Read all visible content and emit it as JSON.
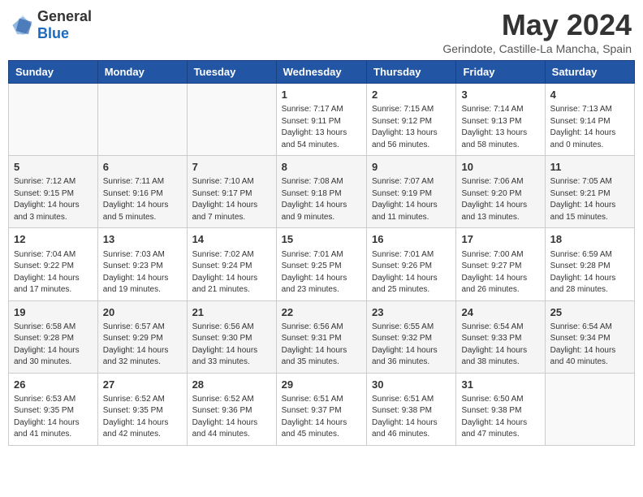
{
  "logo": {
    "general": "General",
    "blue": "Blue"
  },
  "title": "May 2024",
  "subtitle": "Gerindote, Castille-La Mancha, Spain",
  "days_of_week": [
    "Sunday",
    "Monday",
    "Tuesday",
    "Wednesday",
    "Thursday",
    "Friday",
    "Saturday"
  ],
  "weeks": [
    [
      {
        "day": "",
        "info": ""
      },
      {
        "day": "",
        "info": ""
      },
      {
        "day": "",
        "info": ""
      },
      {
        "day": "1",
        "info": "Sunrise: 7:17 AM\nSunset: 9:11 PM\nDaylight: 13 hours\nand 54 minutes."
      },
      {
        "day": "2",
        "info": "Sunrise: 7:15 AM\nSunset: 9:12 PM\nDaylight: 13 hours\nand 56 minutes."
      },
      {
        "day": "3",
        "info": "Sunrise: 7:14 AM\nSunset: 9:13 PM\nDaylight: 13 hours\nand 58 minutes."
      },
      {
        "day": "4",
        "info": "Sunrise: 7:13 AM\nSunset: 9:14 PM\nDaylight: 14 hours\nand 0 minutes."
      }
    ],
    [
      {
        "day": "5",
        "info": "Sunrise: 7:12 AM\nSunset: 9:15 PM\nDaylight: 14 hours\nand 3 minutes."
      },
      {
        "day": "6",
        "info": "Sunrise: 7:11 AM\nSunset: 9:16 PM\nDaylight: 14 hours\nand 5 minutes."
      },
      {
        "day": "7",
        "info": "Sunrise: 7:10 AM\nSunset: 9:17 PM\nDaylight: 14 hours\nand 7 minutes."
      },
      {
        "day": "8",
        "info": "Sunrise: 7:08 AM\nSunset: 9:18 PM\nDaylight: 14 hours\nand 9 minutes."
      },
      {
        "day": "9",
        "info": "Sunrise: 7:07 AM\nSunset: 9:19 PM\nDaylight: 14 hours\nand 11 minutes."
      },
      {
        "day": "10",
        "info": "Sunrise: 7:06 AM\nSunset: 9:20 PM\nDaylight: 14 hours\nand 13 minutes."
      },
      {
        "day": "11",
        "info": "Sunrise: 7:05 AM\nSunset: 9:21 PM\nDaylight: 14 hours\nand 15 minutes."
      }
    ],
    [
      {
        "day": "12",
        "info": "Sunrise: 7:04 AM\nSunset: 9:22 PM\nDaylight: 14 hours\nand 17 minutes."
      },
      {
        "day": "13",
        "info": "Sunrise: 7:03 AM\nSunset: 9:23 PM\nDaylight: 14 hours\nand 19 minutes."
      },
      {
        "day": "14",
        "info": "Sunrise: 7:02 AM\nSunset: 9:24 PM\nDaylight: 14 hours\nand 21 minutes."
      },
      {
        "day": "15",
        "info": "Sunrise: 7:01 AM\nSunset: 9:25 PM\nDaylight: 14 hours\nand 23 minutes."
      },
      {
        "day": "16",
        "info": "Sunrise: 7:01 AM\nSunset: 9:26 PM\nDaylight: 14 hours\nand 25 minutes."
      },
      {
        "day": "17",
        "info": "Sunrise: 7:00 AM\nSunset: 9:27 PM\nDaylight: 14 hours\nand 26 minutes."
      },
      {
        "day": "18",
        "info": "Sunrise: 6:59 AM\nSunset: 9:28 PM\nDaylight: 14 hours\nand 28 minutes."
      }
    ],
    [
      {
        "day": "19",
        "info": "Sunrise: 6:58 AM\nSunset: 9:28 PM\nDaylight: 14 hours\nand 30 minutes."
      },
      {
        "day": "20",
        "info": "Sunrise: 6:57 AM\nSunset: 9:29 PM\nDaylight: 14 hours\nand 32 minutes."
      },
      {
        "day": "21",
        "info": "Sunrise: 6:56 AM\nSunset: 9:30 PM\nDaylight: 14 hours\nand 33 minutes."
      },
      {
        "day": "22",
        "info": "Sunrise: 6:56 AM\nSunset: 9:31 PM\nDaylight: 14 hours\nand 35 minutes."
      },
      {
        "day": "23",
        "info": "Sunrise: 6:55 AM\nSunset: 9:32 PM\nDaylight: 14 hours\nand 36 minutes."
      },
      {
        "day": "24",
        "info": "Sunrise: 6:54 AM\nSunset: 9:33 PM\nDaylight: 14 hours\nand 38 minutes."
      },
      {
        "day": "25",
        "info": "Sunrise: 6:54 AM\nSunset: 9:34 PM\nDaylight: 14 hours\nand 40 minutes."
      }
    ],
    [
      {
        "day": "26",
        "info": "Sunrise: 6:53 AM\nSunset: 9:35 PM\nDaylight: 14 hours\nand 41 minutes."
      },
      {
        "day": "27",
        "info": "Sunrise: 6:52 AM\nSunset: 9:35 PM\nDaylight: 14 hours\nand 42 minutes."
      },
      {
        "day": "28",
        "info": "Sunrise: 6:52 AM\nSunset: 9:36 PM\nDaylight: 14 hours\nand 44 minutes."
      },
      {
        "day": "29",
        "info": "Sunrise: 6:51 AM\nSunset: 9:37 PM\nDaylight: 14 hours\nand 45 minutes."
      },
      {
        "day": "30",
        "info": "Sunrise: 6:51 AM\nSunset: 9:38 PM\nDaylight: 14 hours\nand 46 minutes."
      },
      {
        "day": "31",
        "info": "Sunrise: 6:50 AM\nSunset: 9:38 PM\nDaylight: 14 hours\nand 47 minutes."
      },
      {
        "day": "",
        "info": ""
      }
    ]
  ]
}
